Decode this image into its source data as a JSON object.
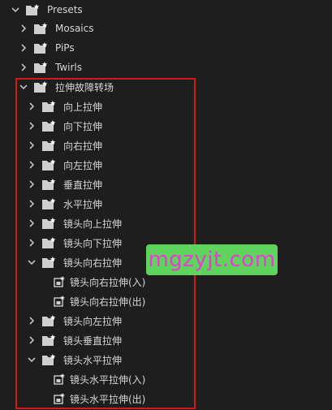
{
  "tree": {
    "presets": "Presets",
    "mosaics": "Mosaics",
    "pips": "PiPs",
    "twirls": "Twirls",
    "stretch_group": "拉伸故障转场",
    "up": "向上拉伸",
    "down": "向下拉伸",
    "right": "向右拉伸",
    "left": "向左拉伸",
    "vertical": "垂直拉伸",
    "horizontal": "水平拉伸",
    "lens_up": "镜头向上拉伸",
    "lens_down": "镜头向下拉伸",
    "lens_right": "镜头向右拉伸",
    "lens_right_in": "镜头向右拉伸(入)",
    "lens_right_out": "镜头向右拉伸(出)",
    "lens_left": "镜头向左拉伸",
    "lens_vertical": "镜头垂直拉伸",
    "lens_horizontal": "镜头水平拉伸",
    "lens_horizontal_in": "镜头水平拉伸(入)",
    "lens_horizontal_out": "镜头水平拉伸(出)"
  },
  "watermark": "mgzyjt.com",
  "colors": {
    "background": "#1e1e1e",
    "text": "#d6d6d6",
    "highlight_border": "#d11b1b",
    "watermark_bg": "#5fd35b",
    "watermark_text": "#e83cd6"
  },
  "icons": {
    "expanded": "chevron-down-icon",
    "collapsed": "chevron-right-icon",
    "bin": "preset-bin-icon",
    "preset": "preset-effect-icon"
  }
}
